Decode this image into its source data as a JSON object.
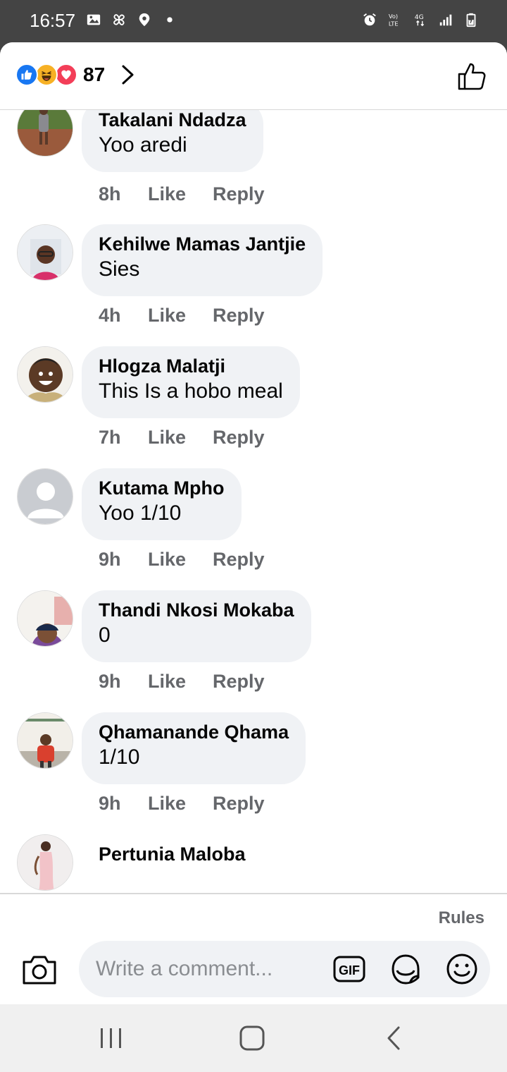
{
  "status_bar": {
    "time": "16:57",
    "left_icons": [
      "gallery-icon",
      "pinwheel-icon",
      "location-icon",
      "dot-icon"
    ],
    "right_icons": [
      "alarm-icon",
      "volte-icon",
      "4g-icon",
      "signal-icon",
      "battery-icon"
    ]
  },
  "header": {
    "reaction_icons": [
      "like",
      "haha",
      "love"
    ],
    "reaction_count": "87"
  },
  "comments": [
    {
      "name": "Takalani Ndadza",
      "text": "Yoo aredi",
      "time": "8h",
      "like": "Like",
      "reply": "Reply"
    },
    {
      "name": "Kehilwe Mamas Jantjie",
      "text": "Sies",
      "time": "4h",
      "like": "Like",
      "reply": "Reply"
    },
    {
      "name": "Hlogza Malatji",
      "text": "This Is a hobo meal",
      "time": "7h",
      "like": "Like",
      "reply": "Reply"
    },
    {
      "name": "Kutama Mpho",
      "text": "Yoo 1/10",
      "time": "9h",
      "like": "Like",
      "reply": "Reply"
    },
    {
      "name": "Thandi Nkosi Mokaba",
      "text": "0",
      "time": "9h",
      "like": "Like",
      "reply": "Reply"
    },
    {
      "name": "Qhamanande Qhama",
      "text": "1/10",
      "time": "9h",
      "like": "Like",
      "reply": "Reply"
    },
    {
      "name": "Pertunia Maloba"
    }
  ],
  "footer": {
    "rules": "Rules",
    "placeholder": "Write a comment...",
    "gif_label": "GIF"
  },
  "colors": {
    "like_blue": "#1877f2",
    "haha_yellow": "#f7b125",
    "love_red": "#f33e58",
    "bubble_bg": "#f0f2f5",
    "meta_gray": "#65676b"
  }
}
